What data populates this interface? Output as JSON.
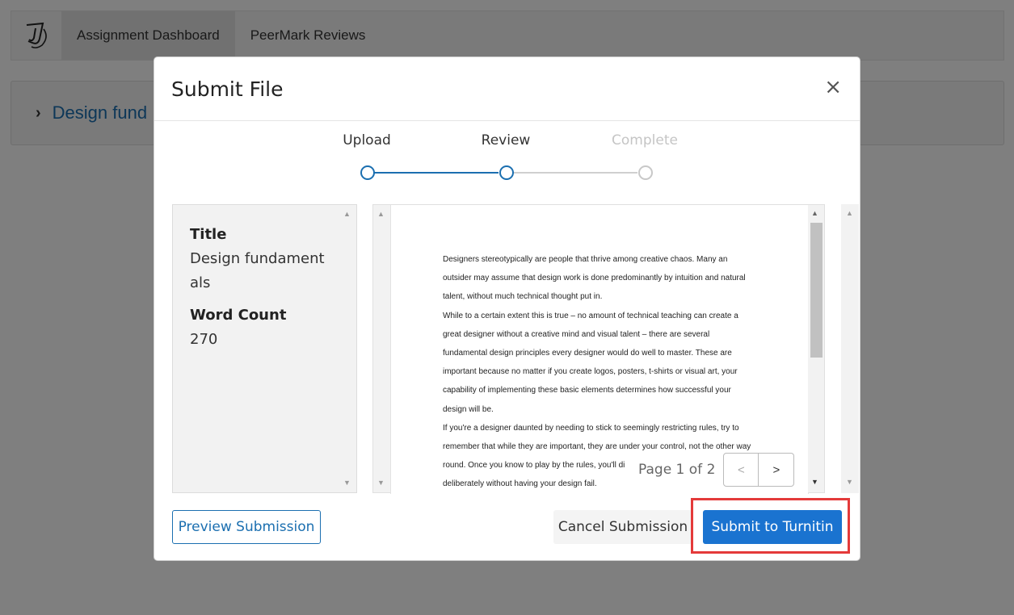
{
  "nav": {
    "tabs": [
      {
        "label": "Assignment Dashboard",
        "active": true
      },
      {
        "label": "PeerMark Reviews",
        "active": false
      }
    ]
  },
  "assignment": {
    "title": "Design fund"
  },
  "modal": {
    "title": "Submit File",
    "close": "×",
    "steps": [
      {
        "label": "Upload",
        "state": "done"
      },
      {
        "label": "Review",
        "state": "current"
      },
      {
        "label": "Complete",
        "state": "pending"
      }
    ],
    "info": {
      "title_label": "Title",
      "title_value": "Design fundamentals",
      "wordcount_label": "Word Count",
      "wordcount_value": "270"
    },
    "document": {
      "lines": [
        "Designers stereotypically are people that thrive among creative chaos. Many an",
        "outsider may assume that design work is done predominantly by intuition and natural",
        "talent, without much technical thought put in.",
        "While to a certain extent this is true – no amount of technical teaching can create a",
        "great designer without a creative mind and visual talent – there are several",
        "fundamental design principles every designer would do well to master. These are",
        "important because no matter if you create logos, posters, t-shirts or visual art, your",
        "capability of implementing these basic elements determines how successful your",
        "design will be.",
        "If you're a designer daunted by needing to stick to seemingly restricting rules, try to",
        "remember that while they are important, they are under your control, not the other way",
        "round. Once you know to play by the rules, you'll di",
        "deliberately without having your design fail."
      ]
    },
    "pager": {
      "text": "Page 1 of 2",
      "prev": "<",
      "next": ">"
    },
    "buttons": {
      "preview": "Preview Submission",
      "cancel": "Cancel Submission",
      "submit": "Submit to Turnitin"
    }
  },
  "colors": {
    "accent": "#1b6fb0",
    "submit": "#1a73d0",
    "highlight": "#e43a3a",
    "muted": "#c5c5c5"
  }
}
